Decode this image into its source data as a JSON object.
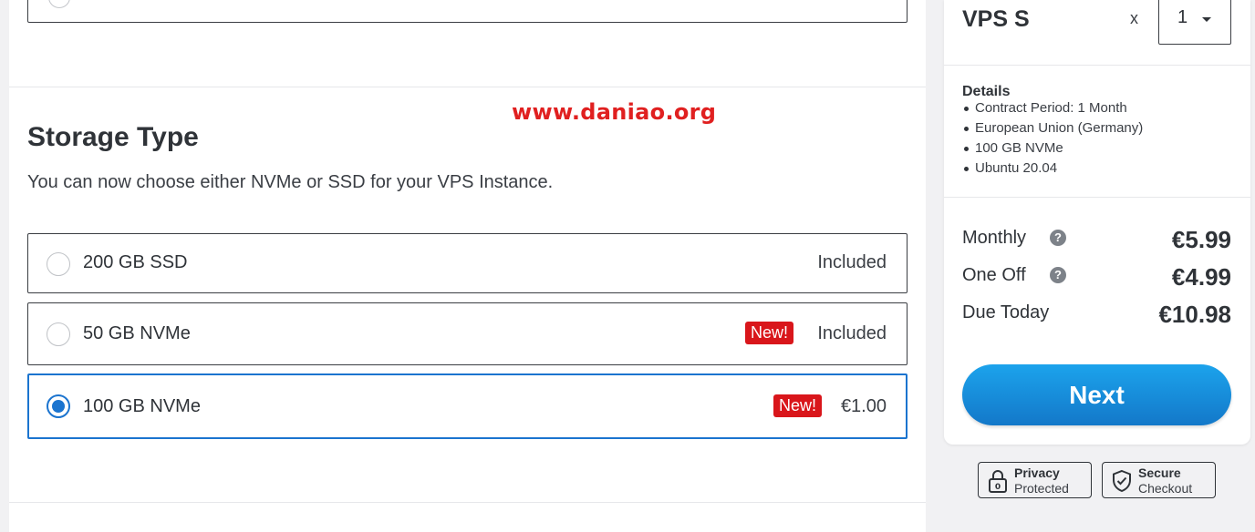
{
  "watermark": "www.daniao.org",
  "storage": {
    "title": "Storage Type",
    "description": "You can now choose either NVMe or SSD for your VPS Instance.",
    "options": [
      {
        "label": "200 GB SSD",
        "price": "Included",
        "badge": "",
        "selected": false
      },
      {
        "label": "50 GB NVMe",
        "price": "Included",
        "badge": "New!",
        "selected": false
      },
      {
        "label": "100 GB NVMe",
        "price": "€1.00",
        "badge": "New!",
        "selected": true
      }
    ]
  },
  "summary": {
    "product": "VPS S",
    "qty_multiplier": "x",
    "quantity": "1",
    "details_title": "Details",
    "details": [
      "Contract Period: 1 Month",
      "European Union (Germany)",
      "100 GB NVMe",
      "Ubuntu 20.04"
    ],
    "prices": [
      {
        "label": "Monthly",
        "value": "€5.99",
        "help": "?"
      },
      {
        "label": "One Off",
        "value": "€4.99",
        "help": "?"
      },
      {
        "label": "Due Today",
        "value": "€10.98"
      }
    ],
    "next_label": "Next"
  },
  "badges": {
    "privacy": {
      "title": "Privacy",
      "sub": "Protected",
      "icon": "lock-icon"
    },
    "secure": {
      "title": "Secure",
      "sub": "Checkout",
      "icon": "shield-icon"
    }
  },
  "colors": {
    "accent": "#1b74cf",
    "new_badge": "#d9161b",
    "watermark": "#e02020",
    "next_button": "#1a8fdc"
  }
}
